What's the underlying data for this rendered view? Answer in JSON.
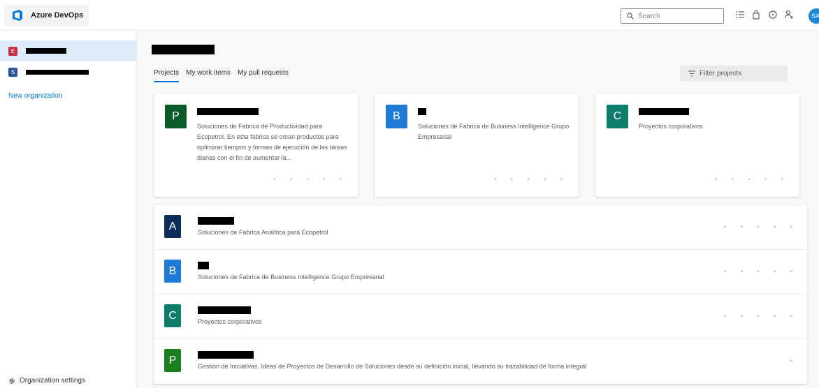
{
  "header": {
    "app_name": "Azure DevOps",
    "search_placeholder": "Search",
    "avatar_initials": "SA"
  },
  "sidebar": {
    "orgs": [
      {
        "badge": "E",
        "color": "#c4314b"
      },
      {
        "badge": "S",
        "color": "#2b579a"
      }
    ],
    "new_org_label": "New organization",
    "settings_label": "Organization settings"
  },
  "main": {
    "tabs": [
      "Projects",
      "My work items",
      "My pull requests"
    ],
    "filter_placeholder": "Filter projects",
    "cards": [
      {
        "letter": "P",
        "color": "#0b5a2a",
        "description": "Soluciones de Fabrica de Productividad para Ecopetrol. En esta fábrica se crean productos para optimizar tiempos y formas de ejecución de las tareas diarias con el fin de aumentar la..."
      },
      {
        "letter": "B",
        "color": "#1f7ad6",
        "description": "Soluciones de Fabrica de Business Intelligence Grupo Empresarial"
      },
      {
        "letter": "C",
        "color": "#0d7c6a",
        "description": "Proyectos corporativos"
      }
    ],
    "rows": [
      {
        "letter": "A",
        "color": "#0f2d5c",
        "description": "Soluciones de Fabrica Analítica para Ecopetrol"
      },
      {
        "letter": "B",
        "color": "#1f7ad6",
        "description": "Soluciones de Fabrica de Business Intelligence Grupo Empresarial"
      },
      {
        "letter": "C",
        "color": "#0d7c6a",
        "description": "Proyectos corporativos"
      },
      {
        "letter": "P",
        "color": "#1a7f1e",
        "description": "Gestión de Iniciativas, Ideas de Proyectos de Desarrollo de Soluciones desde su definición inicial, llevando su trazabilidad de forma integral"
      }
    ],
    "more_dots": "• • • • •",
    "single_dot": "•"
  }
}
